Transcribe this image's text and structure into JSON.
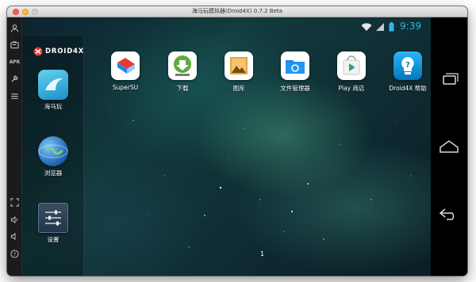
{
  "window": {
    "title": "海马玩模拟器(Droid4X) 0.7.2 Beta"
  },
  "toolbar": {
    "items": [
      {
        "name": "user-icon",
        "glyph": "👤"
      },
      {
        "name": "tv-icon",
        "glyph": "📺"
      },
      {
        "name": "apk-icon",
        "glyph": "APK"
      },
      {
        "name": "wrench-icon",
        "glyph": "🔧"
      },
      {
        "name": "menu-icon",
        "glyph": "☰"
      },
      {
        "name": "fullscreen-icon",
        "glyph": "⤢"
      },
      {
        "name": "volume-up-icon",
        "glyph": "🔊"
      },
      {
        "name": "volume-down-icon",
        "glyph": "🔉"
      },
      {
        "name": "help-icon",
        "glyph": "?"
      }
    ]
  },
  "status": {
    "time": "9:39",
    "icons": [
      "wifi-icon",
      "signal-icon",
      "battery-icon"
    ],
    "accent": "#33b5e5"
  },
  "dock": {
    "logo": "DROID4X",
    "apps": [
      {
        "label": "海马玩",
        "icon": "haimawan-icon"
      },
      {
        "label": "浏览器",
        "icon": "browser-globe-icon"
      },
      {
        "label": "设置",
        "icon": "settings-icon"
      }
    ]
  },
  "home": {
    "apps": [
      {
        "label": "SuperSU",
        "icon": "supersu-icon"
      },
      {
        "label": "下载",
        "icon": "download-icon"
      },
      {
        "label": "图库",
        "icon": "gallery-icon"
      },
      {
        "label": "文件管理器",
        "icon": "file-manager-icon"
      },
      {
        "label": "Play 商店",
        "icon": "play-store-icon"
      },
      {
        "label": "Droid4X 帮助",
        "icon": "droid4x-help-icon"
      }
    ],
    "page": "1"
  },
  "nav": {
    "buttons": [
      "recent-apps-button",
      "home-button",
      "back-button"
    ]
  }
}
